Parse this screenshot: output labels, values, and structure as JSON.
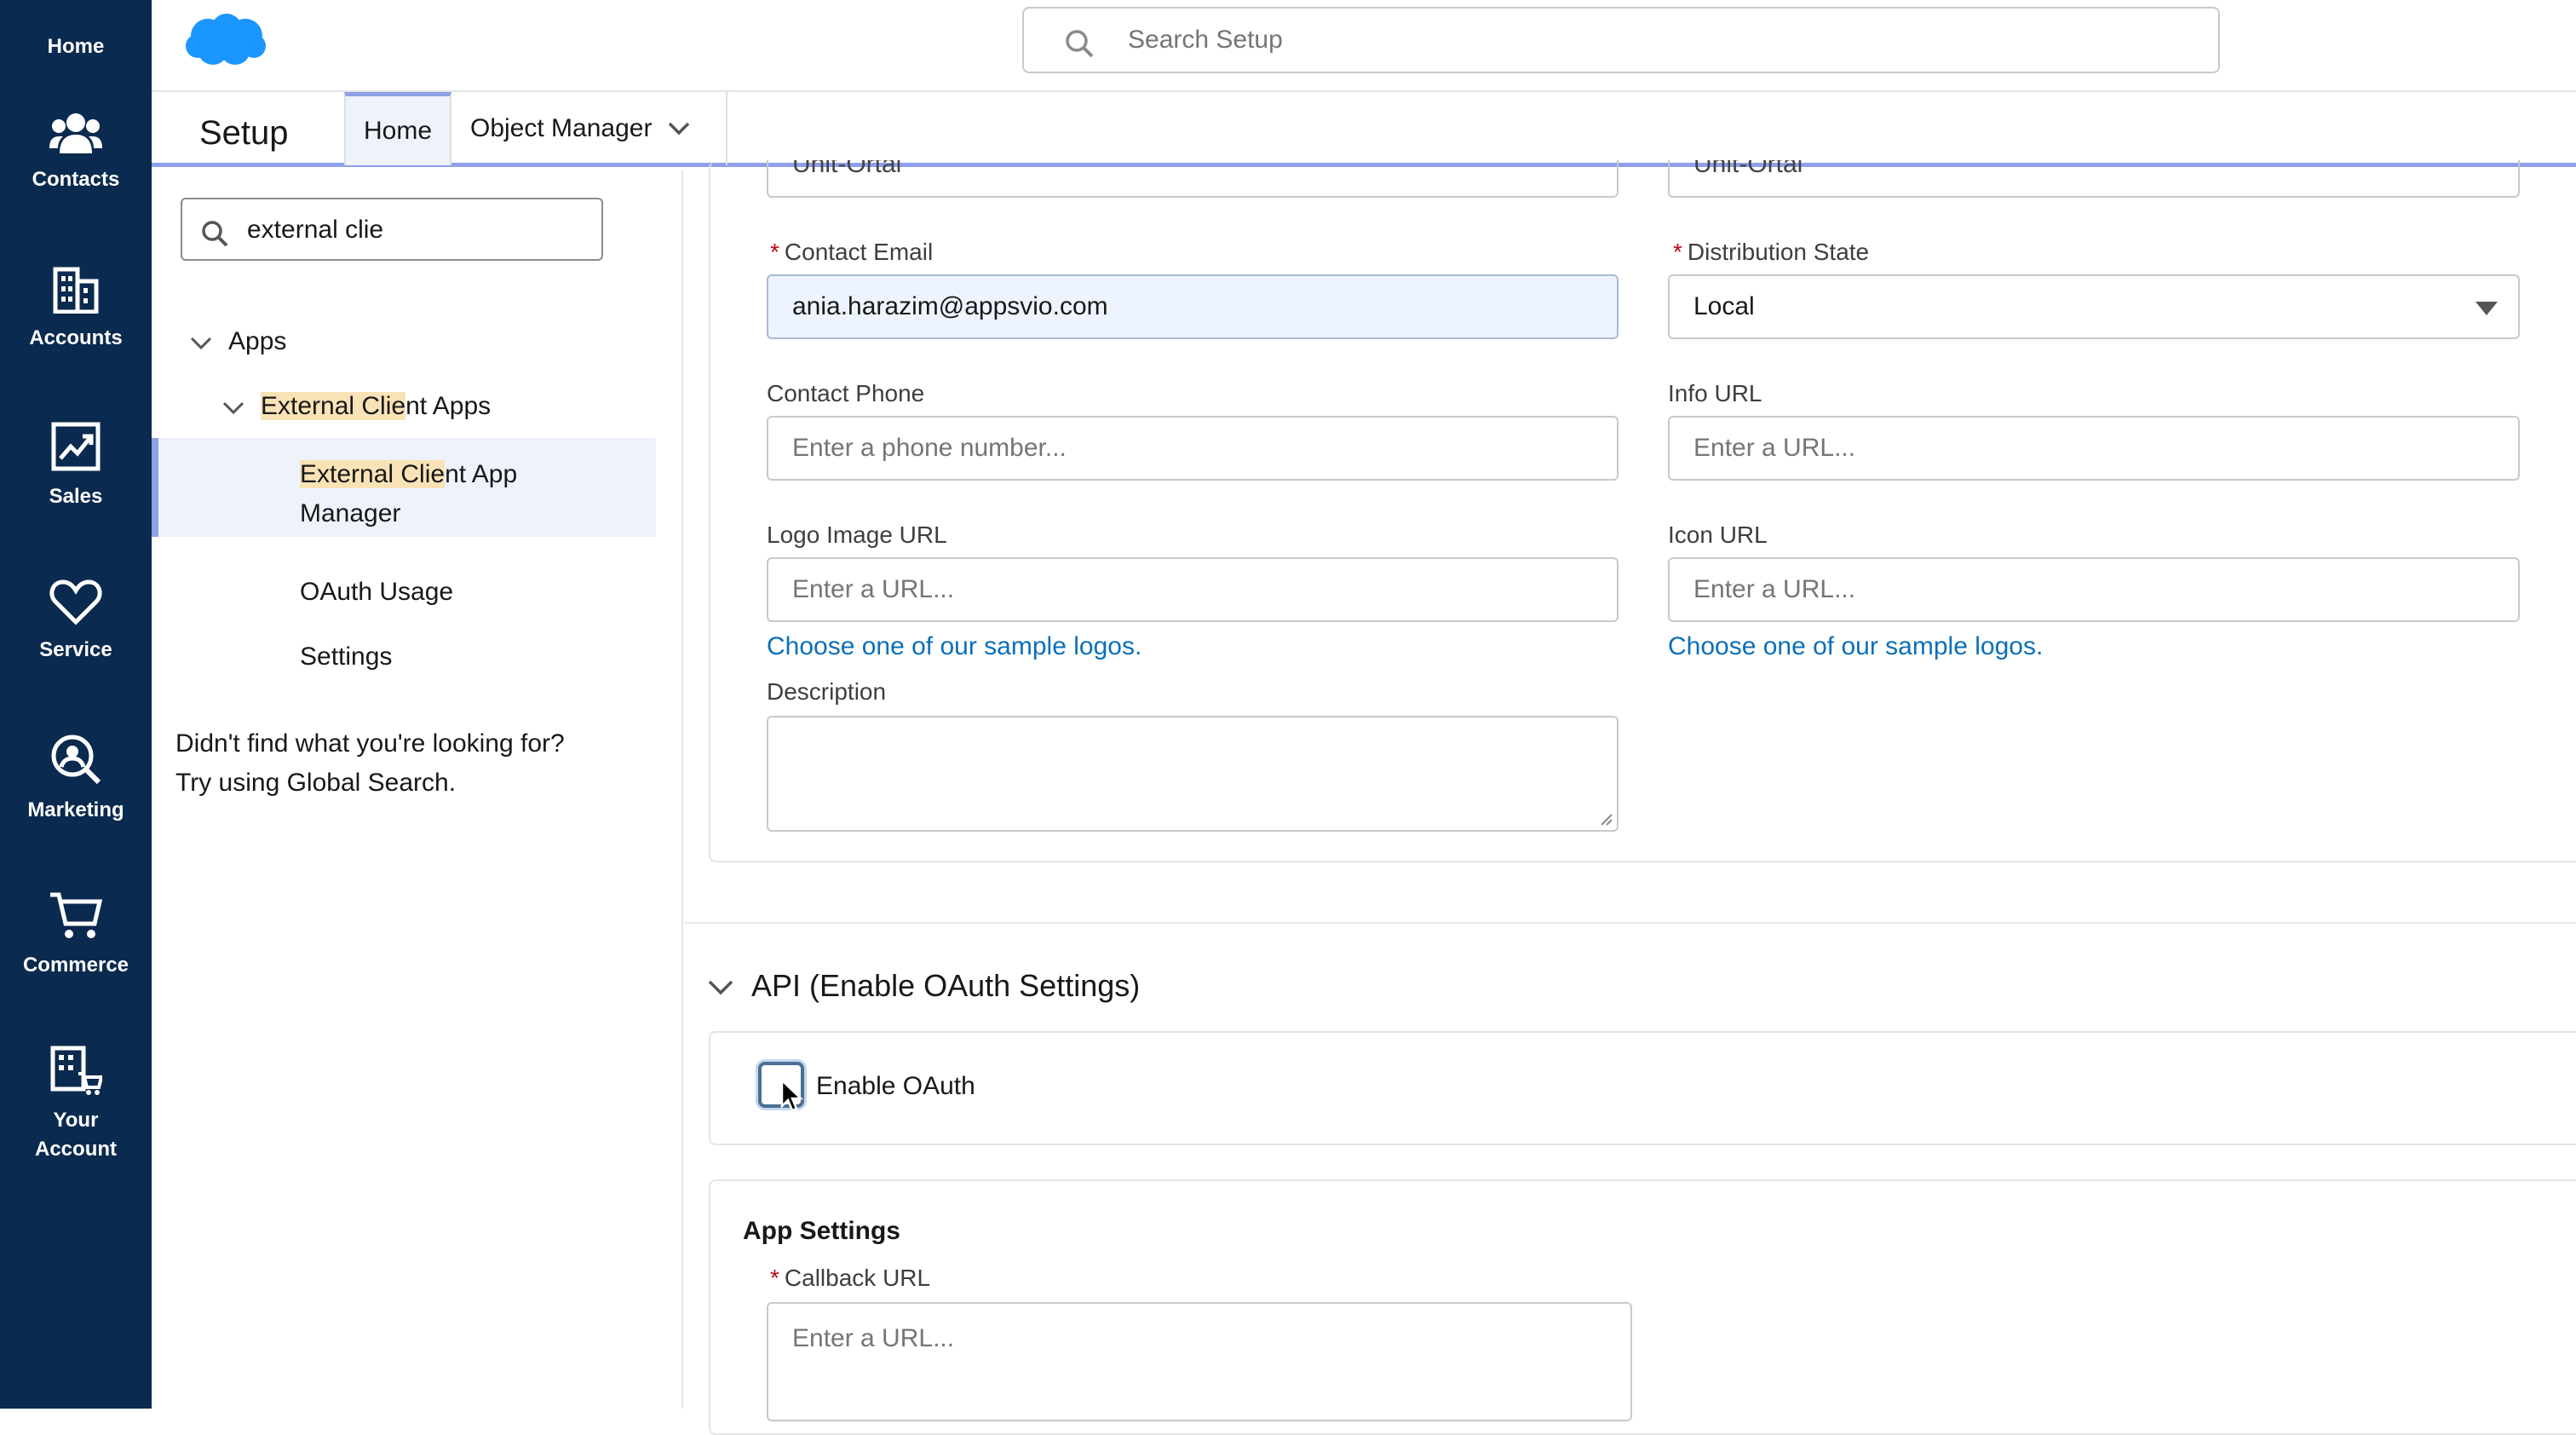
{
  "nav": {
    "items": [
      {
        "label": "Home",
        "icon": "home"
      },
      {
        "label": "Contacts",
        "icon": "contacts-icon"
      },
      {
        "label": "Accounts",
        "icon": "accounts-icon"
      },
      {
        "label": "Sales",
        "icon": "sales-icon"
      },
      {
        "label": "Service",
        "icon": "heart-icon"
      },
      {
        "label": "Marketing",
        "icon": "marketing-icon"
      },
      {
        "label": "Commerce",
        "icon": "cart-icon"
      },
      {
        "label": "Your",
        "label2": "Account",
        "icon": "your-account-icon"
      }
    ]
  },
  "header": {
    "search_placeholder": "Search Setup",
    "brand_color": "#1b96ff"
  },
  "setup": {
    "title": "Setup",
    "tabs": [
      {
        "label": "Home",
        "active": true
      },
      {
        "label": "Object Manager",
        "active": false
      }
    ]
  },
  "sidebar": {
    "quickfind_value": "external clie",
    "tree": {
      "apps": "Apps",
      "external_client_apps": {
        "highlight": "External Clie",
        "rest": "nt Apps"
      },
      "app_manager": {
        "highlight": "External Clie",
        "rest": "nt App",
        "line2": "Manager"
      },
      "oauth_usage": "OAuth Usage",
      "settings": "Settings"
    },
    "not_found_line1": "Didn't find what you're looking for?",
    "not_found_line2": "Try using Global Search."
  },
  "form": {
    "partial_left": "Unit-Ortal",
    "partial_right": "Unit-Ortal",
    "contact_email": {
      "label": "Contact Email",
      "value": "ania.harazim@appsvio.com",
      "required": true
    },
    "distribution_state": {
      "label": "Distribution State",
      "value": "Local",
      "required": true
    },
    "contact_phone": {
      "label": "Contact Phone",
      "placeholder": "Enter a phone number..."
    },
    "info_url": {
      "label": "Info URL",
      "placeholder": "Enter a URL..."
    },
    "logo_image_url": {
      "label": "Logo Image URL",
      "placeholder": "Enter a URL...",
      "link": "Choose one of our sample logos."
    },
    "icon_url": {
      "label": "Icon URL",
      "placeholder": "Enter a URL...",
      "link": "Choose one of our sample logos."
    },
    "description": {
      "label": "Description"
    }
  },
  "api_section": {
    "title": "API (Enable OAuth Settings)",
    "enable_oauth_label": "Enable OAuth"
  },
  "app_settings": {
    "title": "App Settings",
    "callback_url": {
      "label": "Callback URL",
      "placeholder": "Enter a URL...",
      "required": true
    }
  }
}
